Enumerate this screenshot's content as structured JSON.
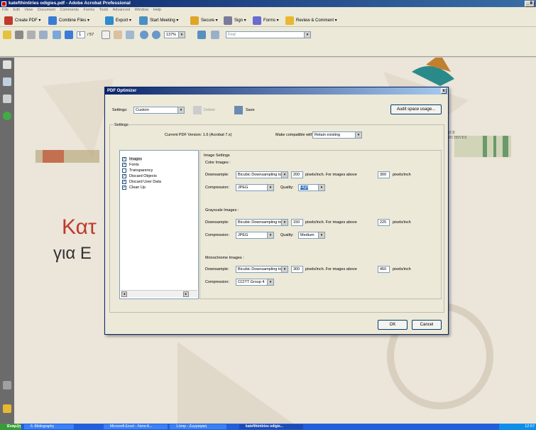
{
  "window": {
    "title": "katefthintiries odigies.pdf - Adobe Acrobat Professional",
    "controls": "_ 8"
  },
  "menu": [
    "File",
    "Edit",
    "View",
    "Document",
    "Comments",
    "Forms",
    "Tools",
    "Advanced",
    "Window",
    "Help"
  ],
  "toolbar1": {
    "create_pdf": "Create PDF",
    "combine_files": "Combine Files",
    "export": "Export",
    "start_meeting": "Start Meeting",
    "secure": "Secure",
    "sign": "Sign",
    "forms": "Forms",
    "review_comment": "Review & Comment"
  },
  "toolbar2": {
    "page_current": "1",
    "page_total": "/ 57",
    "zoom": "137%",
    "find_placeholder": "Find"
  },
  "document": {
    "big_text_1": "Κατ",
    "big_text_2": "για Ε",
    "logo_text_1": "LENCE",
    "logo_text_2": "D ARCHIVES"
  },
  "dialog": {
    "title": "PDF Optimizer",
    "close": "x",
    "settings_label": "Settings:",
    "settings_value": "Custom",
    "delete_label": "Delete",
    "save_label": "Save",
    "audit_label": "Audit space usage...",
    "settings_group": "Settings",
    "current_version": "Current PDF Version: 1.6 (Acrobat 7.x)",
    "make_compatible_label": "Make compatible with:",
    "make_compatible_value": "Retain existing",
    "list_items": [
      {
        "label": "Images",
        "checked": "✓"
      },
      {
        "label": "Fonts",
        "checked": "✓"
      },
      {
        "label": "Transparency",
        "checked": ""
      },
      {
        "label": "Discard Objects",
        "checked": "✓"
      },
      {
        "label": "Discard User Data",
        "checked": "✓"
      },
      {
        "label": "Clean Up",
        "checked": "✓"
      }
    ],
    "image_settings": "Image Settings",
    "color": {
      "heading": "Color Images :",
      "downsample_label": "Downsample:",
      "downsample_value": "Bicubic Downsampling to",
      "ppi": "200",
      "ppi_label": "pixels/inch. For images above",
      "above": "300",
      "above_label": "pixels/inch",
      "compression_label": "Compression:",
      "compression_value": "JPEG",
      "quality_label": "Quality:",
      "quality_value": "High"
    },
    "gray": {
      "heading": "Grayscale Images :",
      "downsample_label": "Downsample:",
      "downsample_value": "Bicubic Downsampling to",
      "ppi": "150",
      "ppi_label": "pixels/inch. For images above",
      "above": "225",
      "above_label": "pixels/inch",
      "compression_label": "Compression:",
      "compression_value": "JPEG",
      "quality_label": "Quality:",
      "quality_value": "Medium"
    },
    "mono": {
      "heading": "Monochrome Images :",
      "downsample_label": "Downsample:",
      "downsample_value": "Bicubic Downsampling to",
      "ppi": "300",
      "ppi_label": "pixels/inch. For images above",
      "above": "450",
      "above_label": "pixels/inch",
      "compression_label": "Compression:",
      "compression_value": "CCITT Group 4"
    },
    "ok_label": "OK",
    "cancel_label": "Cancel"
  },
  "taskbar": {
    "start": "Έναρξη",
    "tasks": [
      "6. Bibliography",
      "Microsoft Excel - Λίστα Α...",
      "1.bmp - Ζωγραφική",
      "katefthintiries odigie..."
    ],
    "clock": "12:57"
  }
}
